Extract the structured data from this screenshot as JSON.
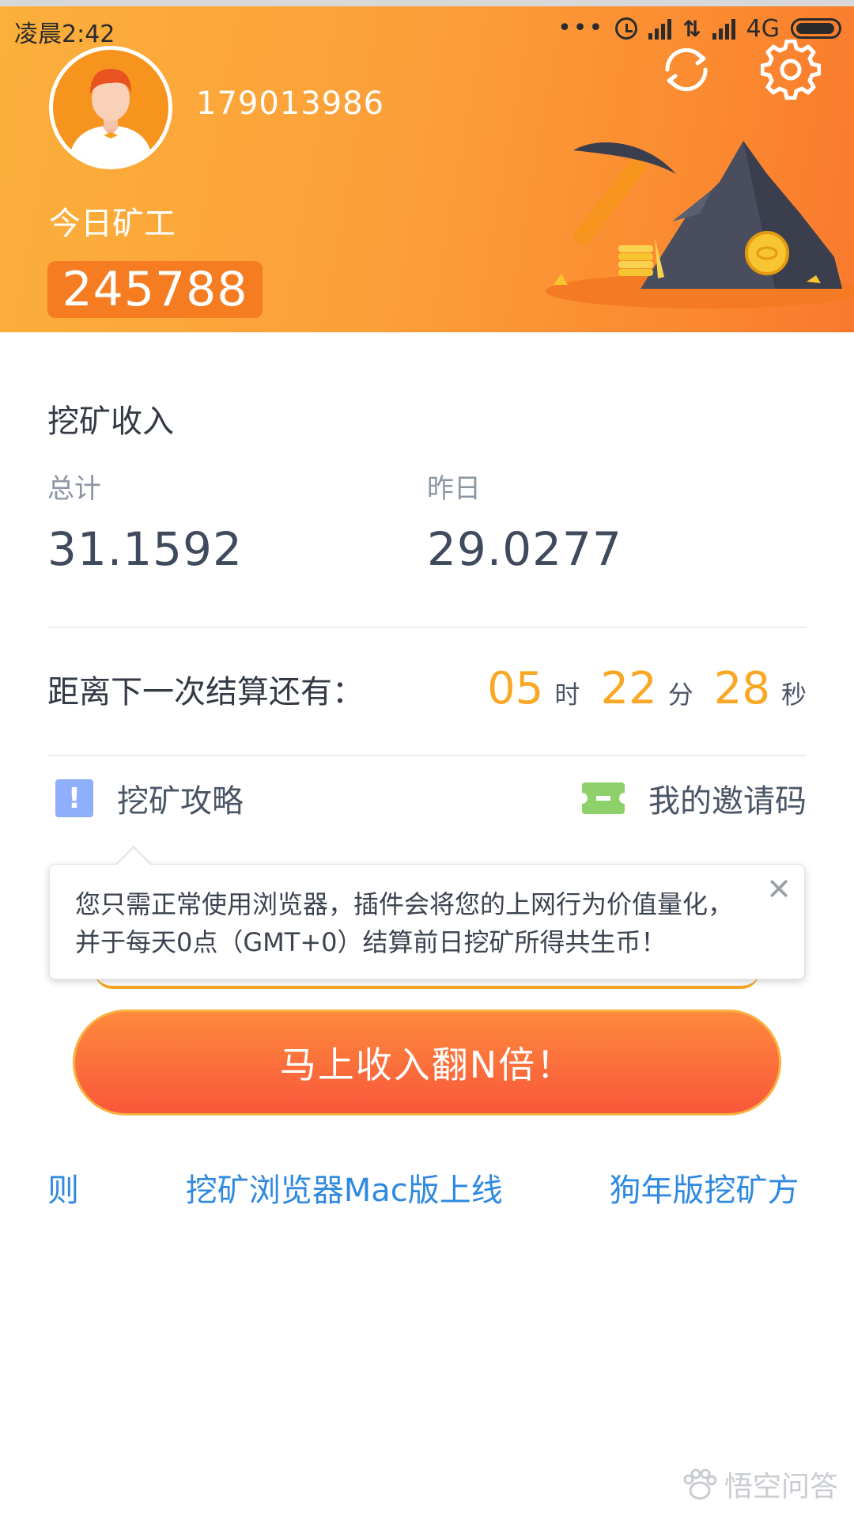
{
  "status_bar": {
    "time": "凌晨2:42",
    "network": "4G"
  },
  "header": {
    "user_id": "179013986",
    "miner_label": "今日矿工",
    "miner_value": "245788",
    "colors": {
      "gradient_start": "#fbb03b",
      "gradient_end": "#f9792e",
      "value_box": "#f57c21"
    },
    "icons": [
      "refresh-icon",
      "settings-gear-icon"
    ]
  },
  "earnings": {
    "title": "挖矿收入",
    "total_label": "总计",
    "total_value": "31.1592",
    "yesterday_label": "昨日",
    "yesterday_value": "29.0277"
  },
  "countdown": {
    "label": "距离下一次结算还有：",
    "hours": "05",
    "hours_unit": "时",
    "minutes": "22",
    "minutes_unit": "分",
    "seconds": "28",
    "seconds_unit": "秒",
    "accent_color": "#f9a825"
  },
  "links": {
    "guide": "挖矿攻略",
    "invite": "我的邀请码"
  },
  "tooltip": {
    "text": "您只需正常使用浏览器，插件会将您的上网行为价值量化，并于每天0点（GMT+0）结算前日挖矿所得共生币！",
    "close": "✕"
  },
  "cta": {
    "label": "马上收入翻N倍！"
  },
  "announcements": [
    "规则",
    "挖矿浏览器Mac版上线",
    "狗年版挖矿方"
  ],
  "watermark": "悟空问答"
}
